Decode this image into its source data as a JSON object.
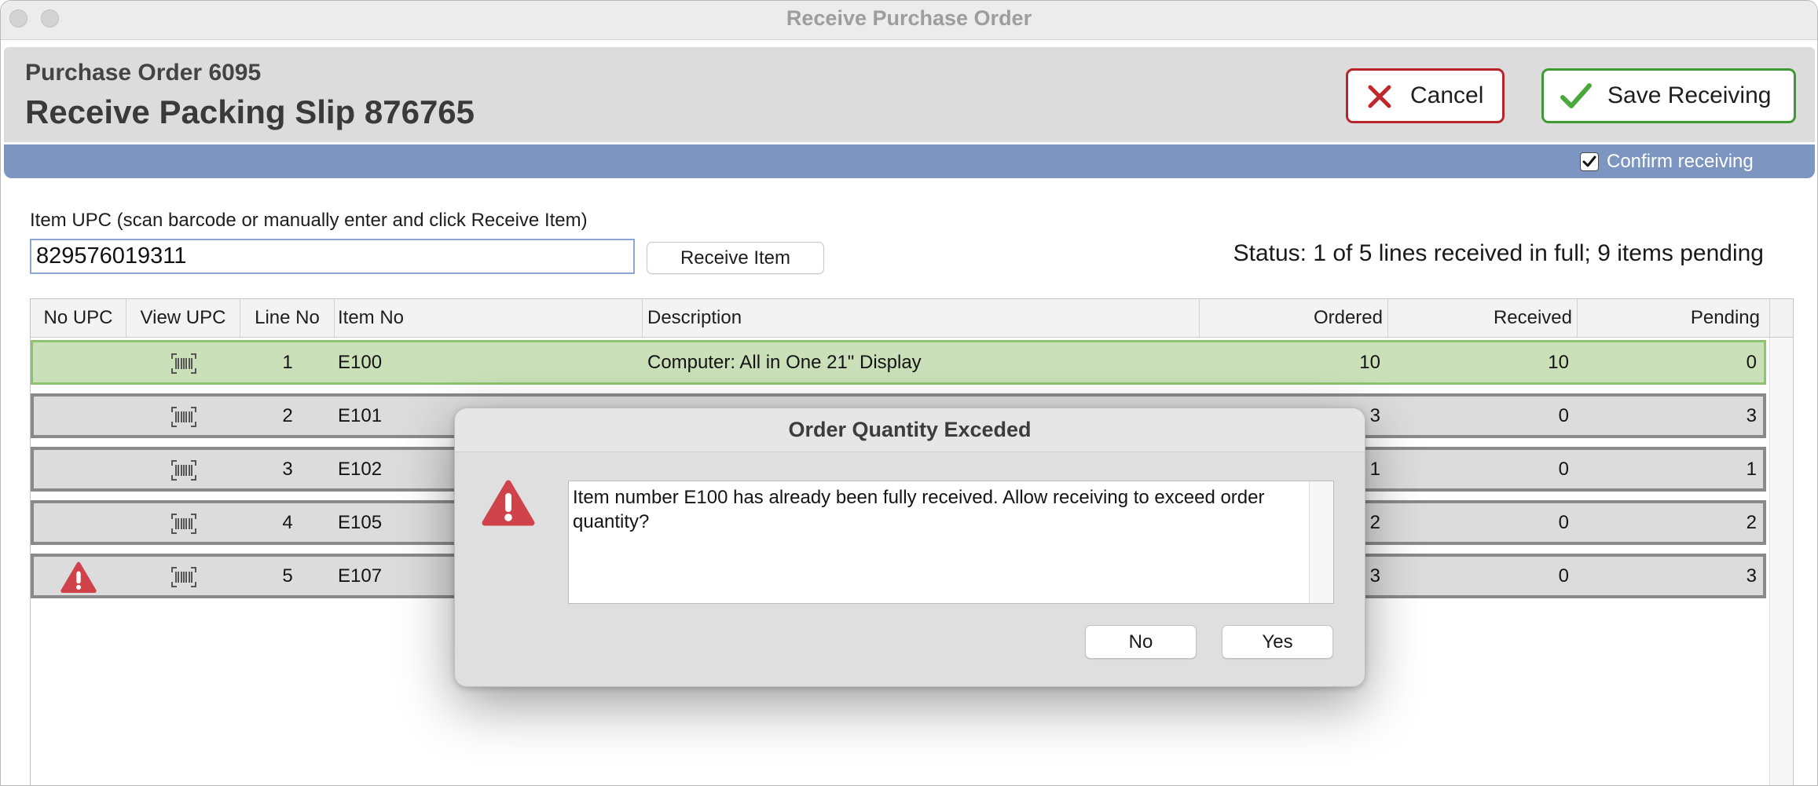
{
  "window": {
    "title": "Receive Purchase Order"
  },
  "header": {
    "purchase_order": "Purchase Order 6095",
    "packing_slip": "Receive Packing Slip 876765",
    "cancel_label": "Cancel",
    "cancel_icon": "x-icon",
    "save_label": "Save Receiving",
    "save_icon": "checkmark-icon"
  },
  "options": {
    "confirm_receiving_label": "Confirm receiving",
    "confirm_receiving_checked": true
  },
  "scan": {
    "label": "Item UPC (scan barcode or manually enter and click Receive Item)",
    "upc_value": "829576019311",
    "receive_button_label": "Receive Item"
  },
  "status": {
    "text": "Status: 1 of 5 lines received in full; 9 items pending"
  },
  "table": {
    "columns": [
      "No UPC",
      "View UPC",
      "Line No",
      "Item No",
      "Description",
      "Ordered",
      "Received",
      "Pending"
    ],
    "rows": [
      {
        "line_no": "1",
        "item_no": "E100",
        "description": "Computer: All in One 21\" Display",
        "ordered": "10",
        "received": "10",
        "pending": "0",
        "highlight": true,
        "view_upc_icon": "barcode-icon"
      },
      {
        "line_no": "2",
        "item_no": "E101",
        "ordered": "3",
        "received": "0",
        "pending": "3",
        "highlight": false,
        "view_upc_icon": "barcode-icon"
      },
      {
        "line_no": "3",
        "item_no": "E102",
        "ordered": "1",
        "received": "0",
        "pending": "1",
        "highlight": false,
        "view_upc_icon": "barcode-icon"
      },
      {
        "line_no": "4",
        "item_no": "E105",
        "ordered": "2",
        "received": "0",
        "pending": "2",
        "highlight": false,
        "view_upc_icon": "barcode-icon"
      },
      {
        "line_no": "5",
        "item_no": "E107",
        "ordered": "3",
        "received": "0",
        "pending": "3",
        "highlight": false,
        "no_upc_icon": "warning-icon",
        "view_upc_icon": "barcode-icon"
      }
    ]
  },
  "dialog": {
    "title": "Order Quantity Exceded",
    "icon": "warning-icon",
    "message": "Item number E100 has already been fully received. Allow receiving to exceed order quantity?",
    "no_label": "No",
    "yes_label": "Yes"
  },
  "colors": {
    "options_bar": "#7d96c1",
    "received_row_bg": "#c9e0b9",
    "received_row_border": "#8dc46f",
    "pending_row_bg": "#dcdcdc",
    "cancel_red": "#b8262b",
    "save_green": "#3f9a34",
    "warning_red": "#d1434b"
  }
}
